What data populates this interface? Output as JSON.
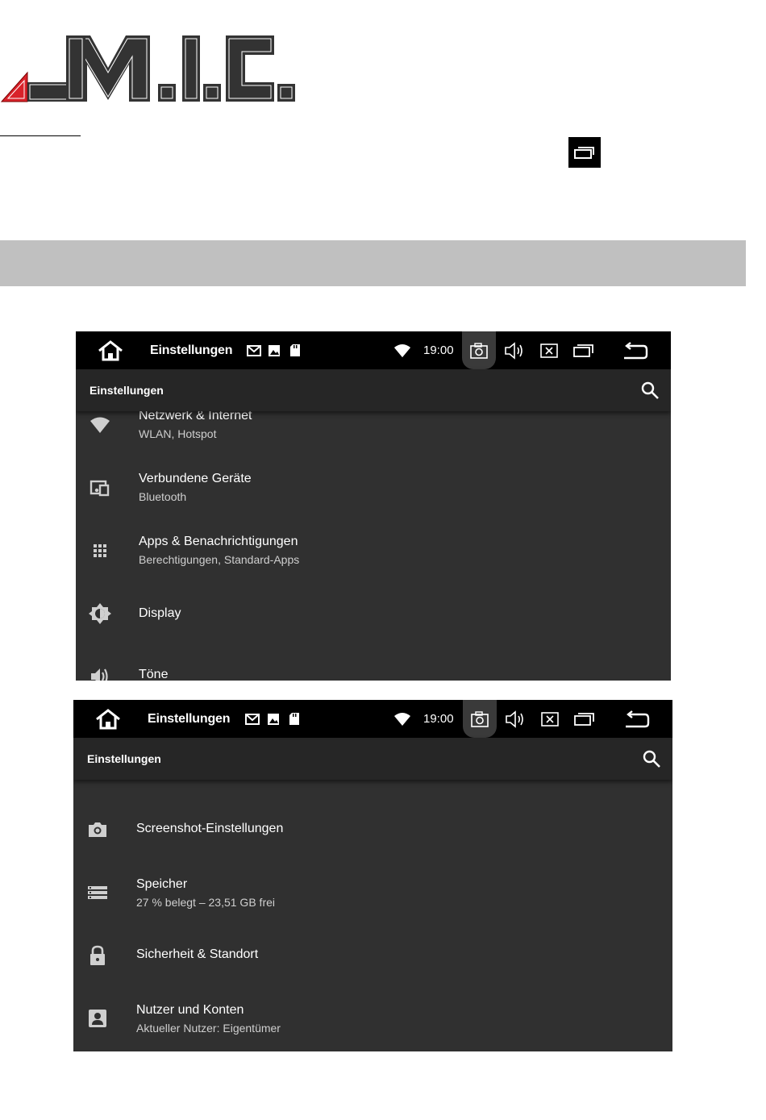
{
  "document": {
    "logo_text": "M.I.C."
  },
  "screens": [
    {
      "statusbar": {
        "title": "Einstellungen",
        "time": "19:00"
      },
      "appbar": {
        "title": "Einstellungen"
      },
      "items": [
        {
          "icon": "wifi-icon",
          "title": "Netzwerk & Internet",
          "subtitle": "WLAN, Hotspot"
        },
        {
          "icon": "devices-icon",
          "title": "Verbundene Geräte",
          "subtitle": "Bluetooth"
        },
        {
          "icon": "apps-grid-icon",
          "title": "Apps & Benachrichtigungen",
          "subtitle": "Berechtigungen, Standard-Apps"
        },
        {
          "icon": "brightness-icon",
          "title": "Display",
          "subtitle": ""
        },
        {
          "icon": "volume-icon",
          "title": "Töne",
          "subtitle": ""
        }
      ]
    },
    {
      "statusbar": {
        "title": "Einstellungen",
        "time": "19:00"
      },
      "appbar": {
        "title": "Einstellungen"
      },
      "items": [
        {
          "icon": "camera-icon",
          "title": "Screenshot-Einstellungen",
          "subtitle": ""
        },
        {
          "icon": "storage-icon",
          "title": "Speicher",
          "subtitle": "27 % belegt – 23,51 GB frei"
        },
        {
          "icon": "lock-icon",
          "title": "Sicherheit & Standort",
          "subtitle": ""
        },
        {
          "icon": "account-icon",
          "title": "Nutzer und Konten",
          "subtitle": "Aktueller Nutzer: Eigentümer"
        }
      ]
    }
  ],
  "colors": {
    "statusbar_bg": "#000000",
    "appbar_bg": "#262626",
    "list_bg": "#303030",
    "logo_red": "#d9222a",
    "band_gray": "#c0c0c0"
  }
}
